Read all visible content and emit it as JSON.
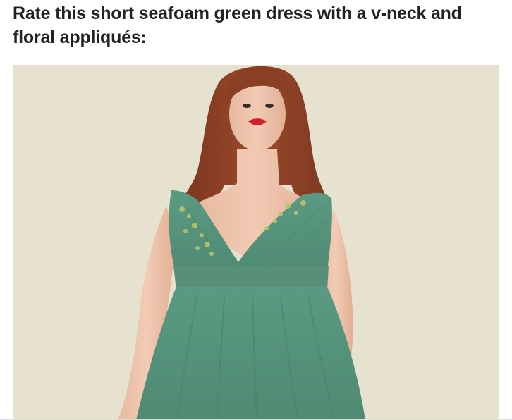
{
  "question": {
    "title": "Rate this short seafoam green dress with a v-neck and floral appliqués:"
  },
  "photo": {
    "subject": "model wearing seafoam green v-neck dress with floral appliqués",
    "dress_color": "#5f9e86",
    "background_color": "#e7e1d0",
    "hair_color": "#8e4327",
    "lip_color": "#d21f2b"
  }
}
